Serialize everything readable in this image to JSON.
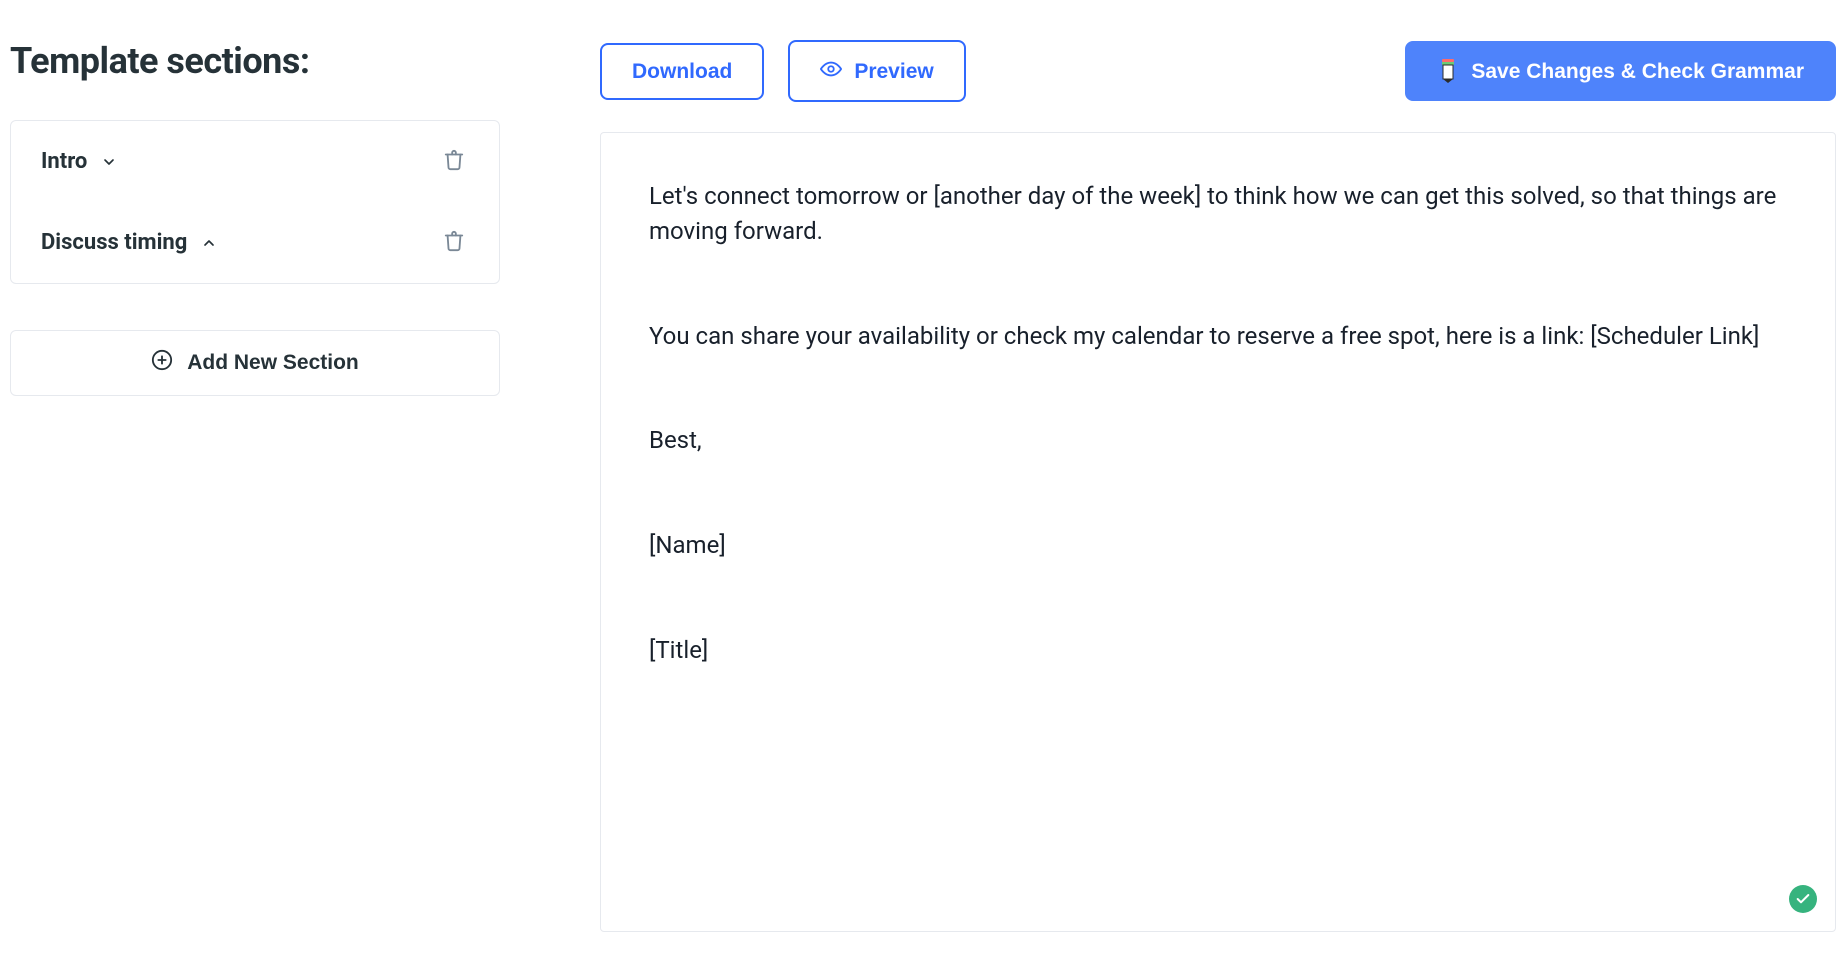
{
  "sidebar": {
    "heading": "Template sections:",
    "sections": [
      {
        "label": "Intro",
        "expanded": false
      },
      {
        "label": "Discuss timing",
        "expanded": true
      }
    ],
    "add_button_label": "Add New Section"
  },
  "toolbar": {
    "download_label": "Download",
    "preview_label": "Preview",
    "save_label": "Save Changes & Check Grammar"
  },
  "editor": {
    "paragraphs": [
      "Let's connect tomorrow or [another day of the week] to think how we can get this solved, so that things are moving forward.",
      "You can share your availability or check my calendar to reserve a free spot, here is a link: [Scheduler Link]",
      "Best,",
      "[Name]",
      "[Title]"
    ]
  },
  "status": {
    "ok": true
  }
}
